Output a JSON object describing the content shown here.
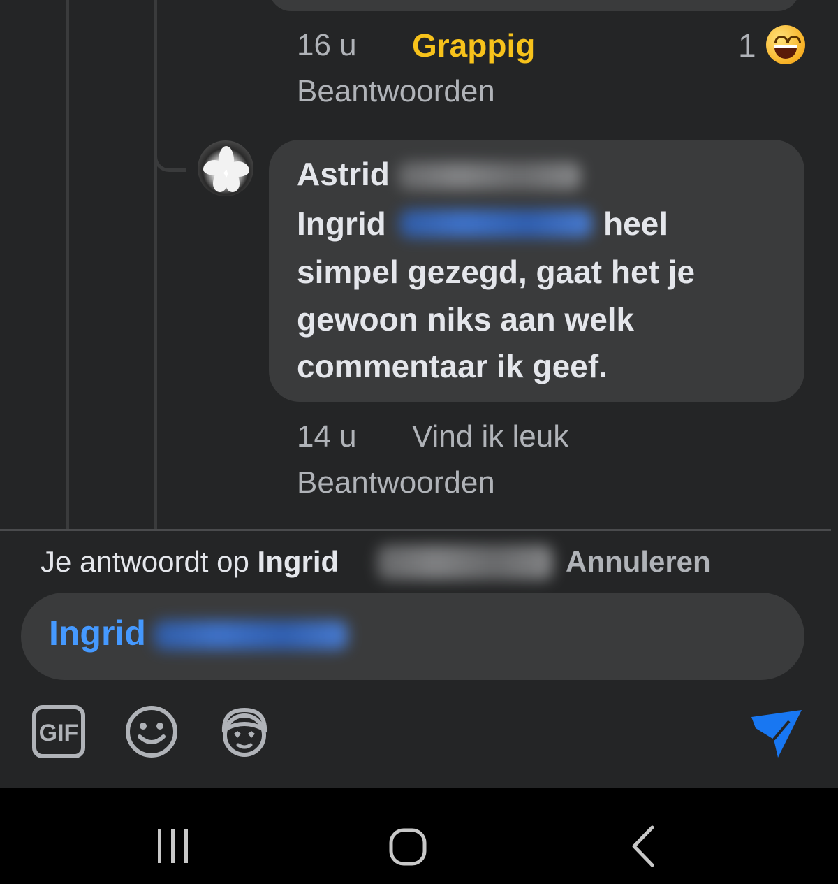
{
  "prev_comment": {
    "time": "16 u",
    "reaction_label": "Grappig",
    "reply_label": "Beantwoorden",
    "reaction_count": "1",
    "reaction_icon": "laughing-face-icon"
  },
  "reply_comment": {
    "author_first": "Astrid",
    "mention": "Ingrid",
    "line1_end": "heel",
    "line2": "simpel gezegd, gaat het je",
    "line3": "gewoon niks aan welk",
    "line4": "commentaar ik geef.",
    "time": "14 u",
    "like_label": "Vind ik leuk",
    "reply_label": "Beantwoorden"
  },
  "reply_bar": {
    "prefix": "Je antwoordt op",
    "name": "Ingrid",
    "cancel_label": "Annuleren"
  },
  "composer": {
    "mention": "Ingrid"
  },
  "toolbar": {
    "gif_label": "GIF",
    "icons": [
      "gif-icon",
      "emoji-icon",
      "avatar-sticker-icon",
      "send-icon"
    ]
  },
  "navbar": {
    "icons": [
      "recent-apps-icon",
      "home-icon",
      "back-icon"
    ]
  },
  "colors": {
    "background": "#242526",
    "bubble": "#3a3b3c",
    "mention_blue": "#2d88ff",
    "reaction_yellow": "#f7c21b",
    "send_blue": "#1877f2"
  }
}
